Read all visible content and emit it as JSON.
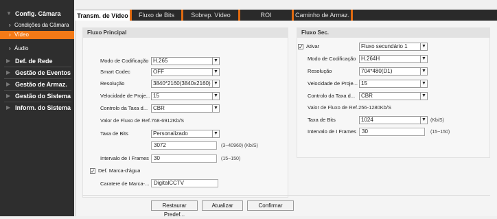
{
  "sidebar": {
    "camera_settings": "Config. Câmara",
    "camera_conditions": "Condições da Câmara",
    "video": "Vídeo",
    "audio": "Áudio",
    "network": "Def. de Rede",
    "event_mgmt": "Gestão de Eventos",
    "storage_mgmt": "Gestão de Armaz.",
    "system_mgmt": "Gestão do Sistema",
    "system_info": "Inform. do Sistema"
  },
  "tabs": [
    "Transm. de Vídeo",
    "Fluxo de Bits",
    "Sobrep. Vídeo",
    "ROI",
    "Caminho de Armaz."
  ],
  "main_stream": {
    "title": "Fluxo Principal",
    "encoding_label": "Modo de Codificação",
    "encoding_value": "H.265",
    "smart_codec_label": "Smart Codec",
    "smart_codec_value": "OFF",
    "resolution_label": "Resolução",
    "resolution_value": "3840*2160(3840x2160)",
    "frame_rate_label": "Velocidade de Proje...",
    "frame_rate_value": "15",
    "bitrate_control_label": "Controlo da Taxa d...",
    "bitrate_control_value": "CBR",
    "ref_bitrate_text": "Valor de Fluxo de Ref.768-6912Kb/S",
    "bitrate_label": "Taxa de Bits",
    "bitrate_mode": "Personalizado",
    "bitrate_value": "3072",
    "bitrate_hint": "(3~40960) (Kb/S)",
    "iframe_label": "Intervalo de I Frames",
    "iframe_value": "30",
    "iframe_hint": "(15~150)",
    "watermark_label": "Def. Marca-d'água",
    "watermark_checked": true,
    "watermark_text_label": "Caratere de Marca-...",
    "watermark_text_value": "DigitalCCTV"
  },
  "sub_stream": {
    "title": "Fluxo Sec.",
    "enable_label": "Ativar",
    "enable_checked": true,
    "stream_select": "Fluxo secundário 1",
    "encoding_label": "Modo de Codificação",
    "encoding_value": "H.264H",
    "resolution_label": "Resolução",
    "resolution_value": "704*480(D1)",
    "frame_rate_label": "Velocidade de Proje...",
    "frame_rate_value": "15",
    "bitrate_control_label": "Controlo da Taxa d...",
    "bitrate_control_value": "CBR",
    "ref_bitrate_text": "Valor de Fluxo de Ref.256-1280Kb/S",
    "bitrate_label": "Taxa de Bits",
    "bitrate_value": "1024",
    "bitrate_unit": "(Kb/S)",
    "iframe_label": "Intervalo de I Frames",
    "iframe_value": "30",
    "iframe_hint": "(15~150)"
  },
  "buttons": {
    "restore": "Restaurar Predef...",
    "refresh": "Atualizar",
    "confirm": "Confirmar"
  },
  "colors": {
    "accent": "#f47a17",
    "sidebar_bg": "#2e2e2e",
    "tab_bar": "#2a2a2a"
  },
  "icons": {
    "dropdown": "chevron-down-icon",
    "check": "checkmark-icon",
    "nav": "chevron-right-icon"
  }
}
